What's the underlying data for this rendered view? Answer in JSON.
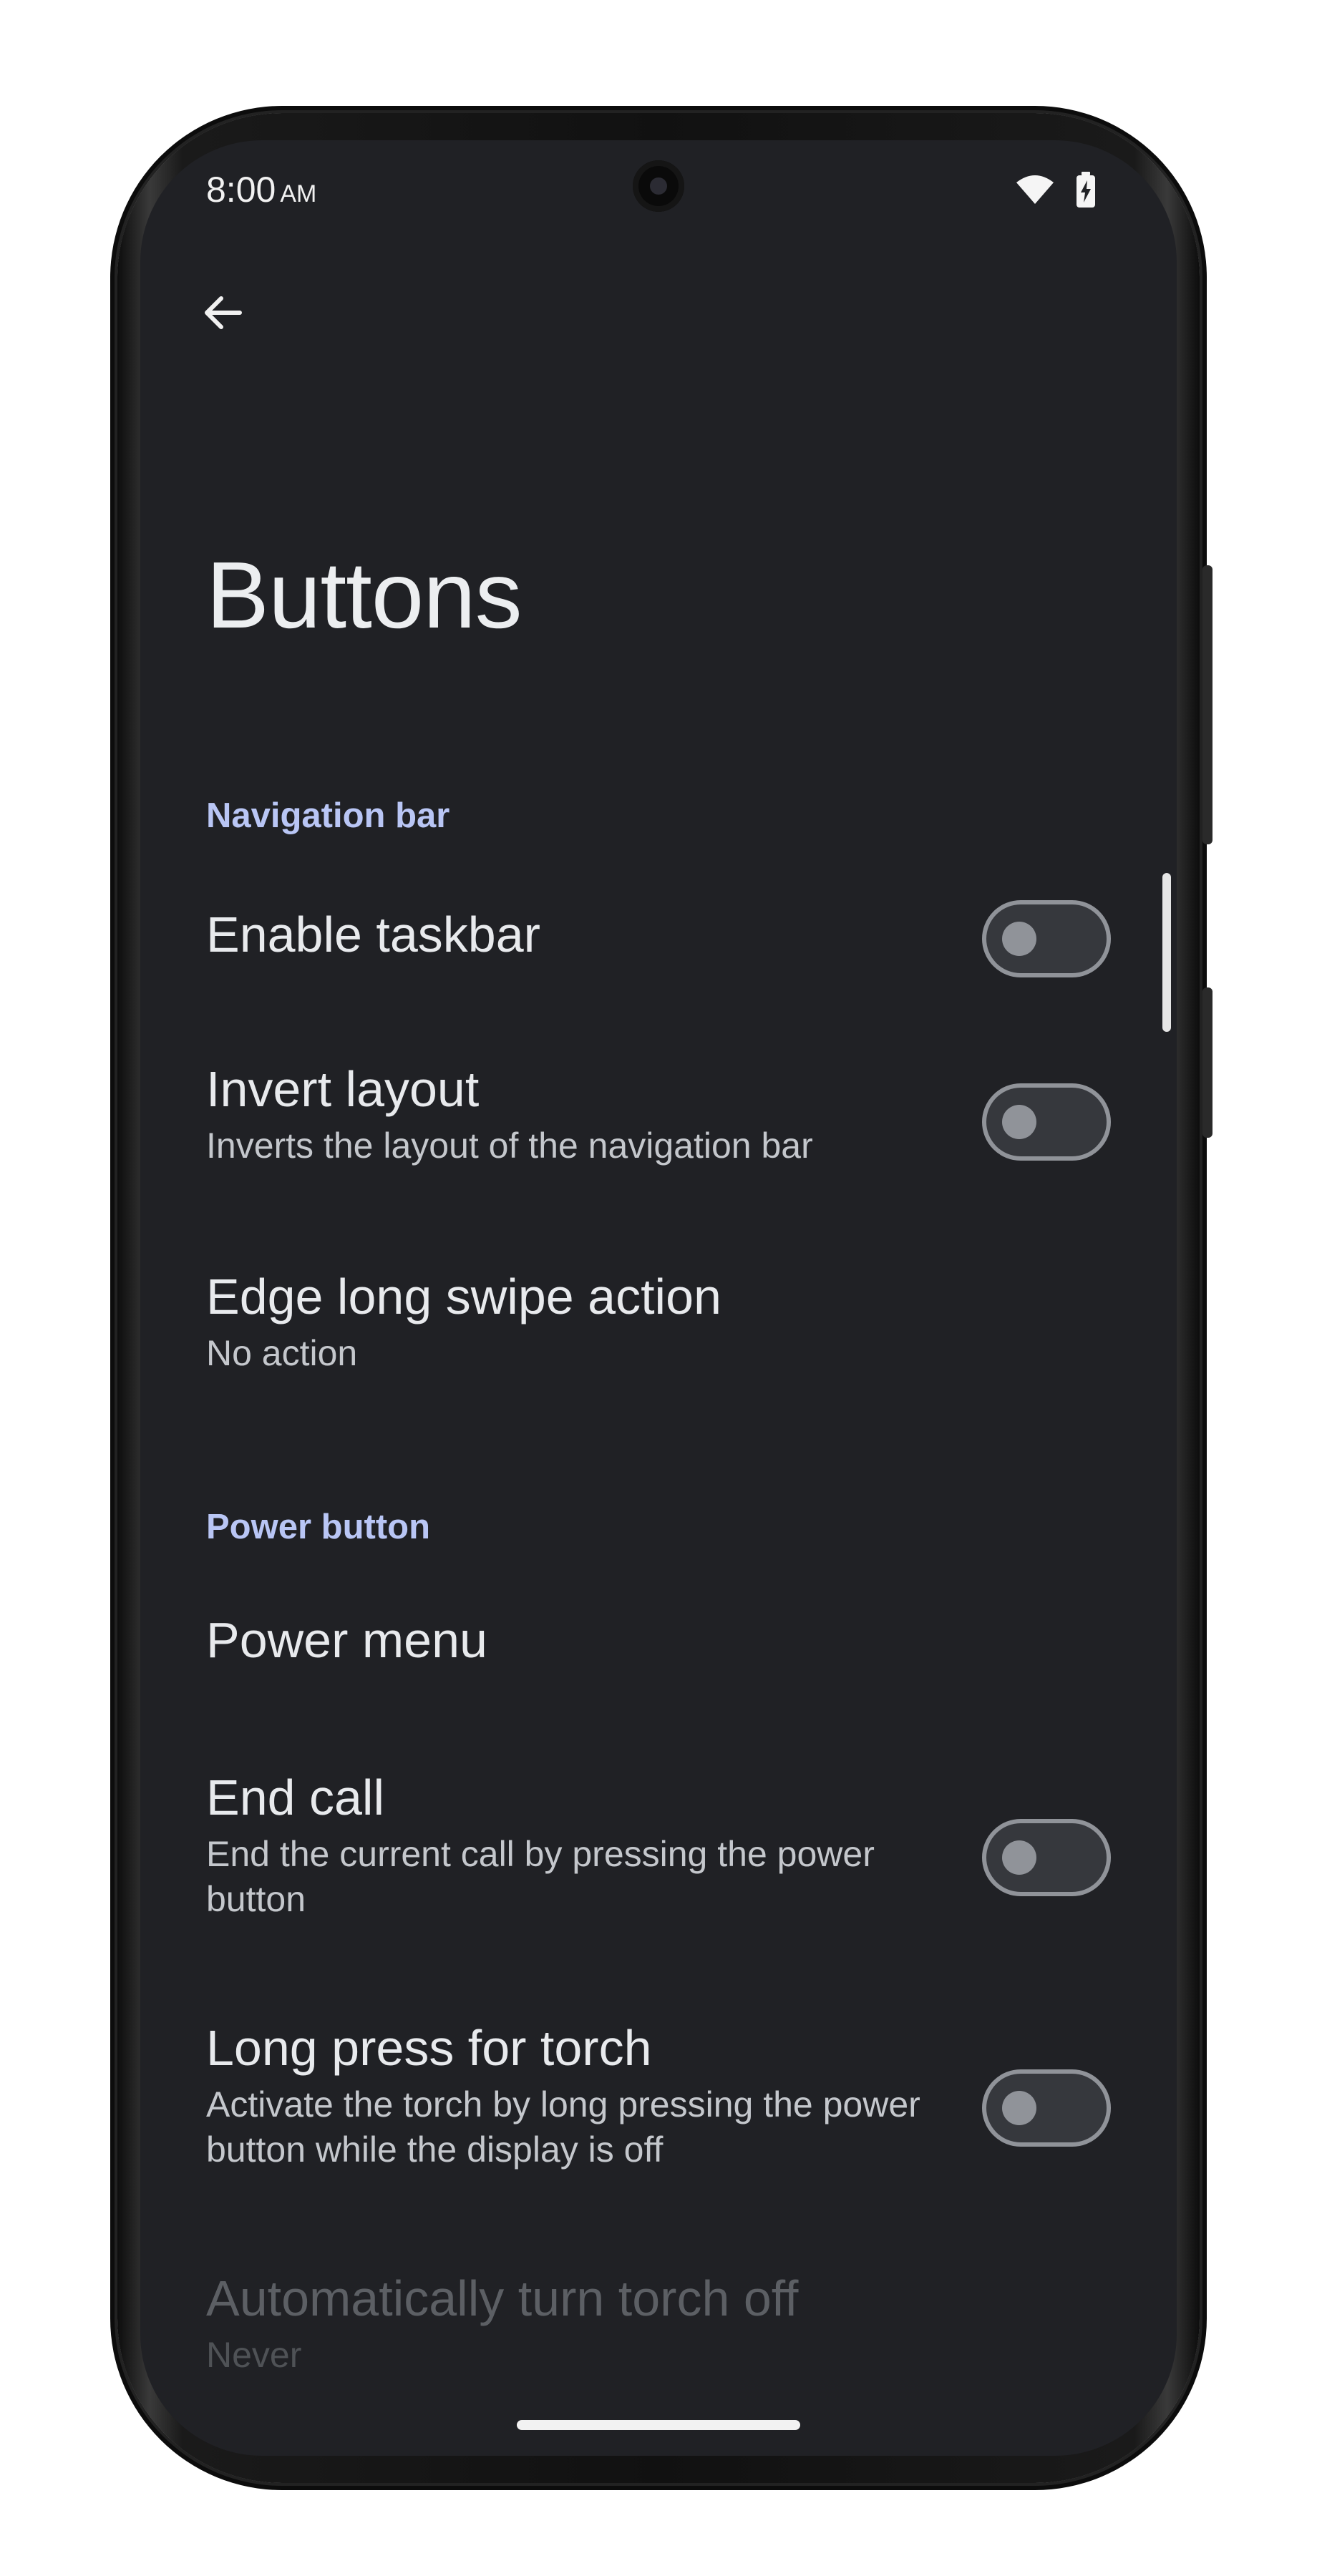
{
  "status_bar": {
    "time": "8:00",
    "ampm": "AM",
    "wifi_icon": "wifi-icon",
    "battery_icon": "battery-charging-icon"
  },
  "header": {
    "back_icon": "arrow-back-icon",
    "title": "Buttons"
  },
  "sections": {
    "navigation_bar": "Navigation bar",
    "power_button": "Power button"
  },
  "prefs": {
    "enable_taskbar": {
      "title": "Enable taskbar",
      "enabled": false
    },
    "invert_layout": {
      "title": "Invert layout",
      "summary": "Inverts the layout of the navigation bar",
      "enabled": false
    },
    "edge_long_swipe": {
      "title": "Edge long swipe action",
      "summary": "No action"
    },
    "power_menu": {
      "title": "Power menu"
    },
    "end_call": {
      "title": "End call",
      "summary": "End the current call by pressing the power button",
      "enabled": false
    },
    "long_press_torch": {
      "title": "Long press for torch",
      "summary": "Activate the torch by long pressing the power button while the display is off",
      "enabled": false
    },
    "auto_torch_off": {
      "title": "Automatically turn torch off",
      "summary": "Never"
    }
  }
}
